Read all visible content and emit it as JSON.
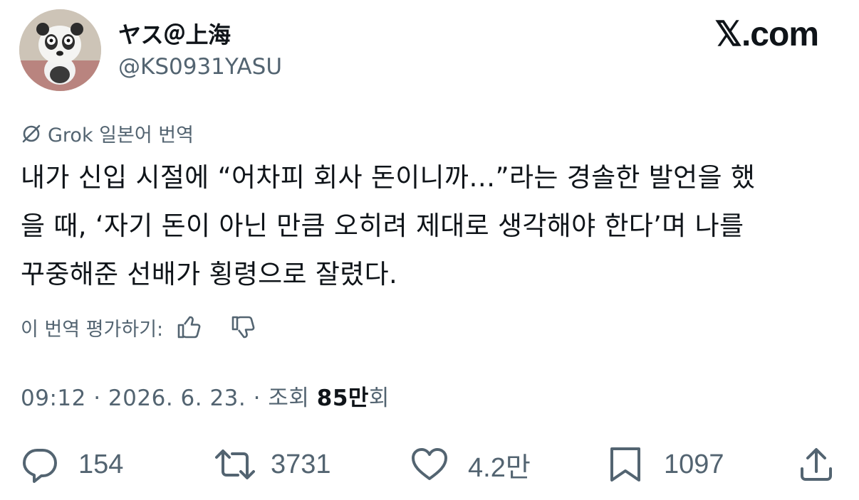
{
  "user": {
    "display_name": "ヤス＠上海",
    "handle": "@KS0931YASU",
    "avatar": "panda-avatar"
  },
  "site_logo": "𝕏.com",
  "translation": {
    "label": "Grok 일본어 번역",
    "icon": "grok-icon"
  },
  "tweet": {
    "lines": [
      "내가 신입 시절에 “어차피 회사 돈이니까…”라는 경솔한 발언을 했",
      "을 때, ‘자기 돈이 아닌 만큼 오히려 제대로 생각해야 한다’며 나를",
      "꾸중해준 선배가 횡령으로 잘렸다."
    ]
  },
  "rate": {
    "label": "이 번역 평가하기:",
    "up_icon": "thumbs-up-icon",
    "down_icon": "thumbs-down-icon"
  },
  "meta": {
    "time": "09:12",
    "sep": "·",
    "date": "2026. 6. 23.",
    "views_prefix": "조회",
    "views_count": "85만",
    "views_suffix": "회"
  },
  "actions": {
    "replies": "154",
    "retweets": "3731",
    "likes": "4.2만",
    "bookmarks": "1097"
  },
  "colors": {
    "text": "#0f1419",
    "secondary": "#536471"
  }
}
